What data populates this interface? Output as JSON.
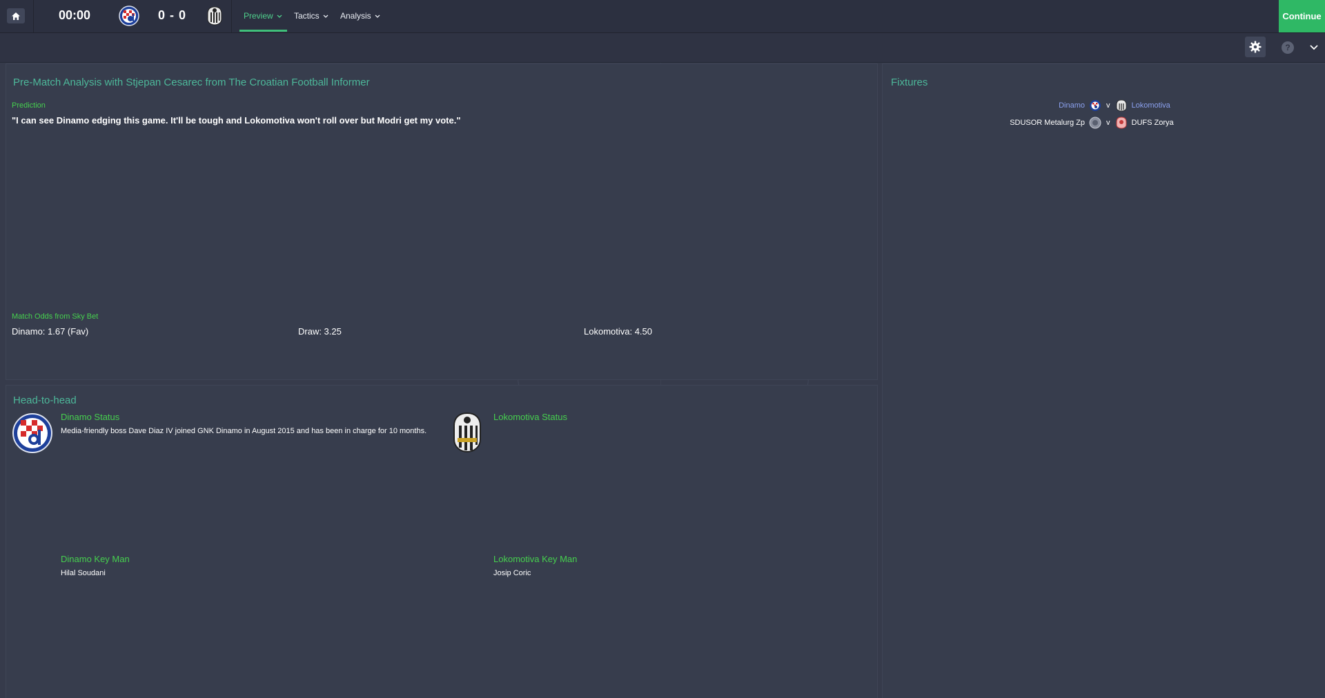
{
  "topbar": {
    "clock": "00:00",
    "score": "0 - 0",
    "tabs": [
      {
        "label": "Preview",
        "active": true
      },
      {
        "label": "Tactics",
        "active": false
      },
      {
        "label": "Analysis",
        "active": false
      }
    ],
    "continue_label": "Continue"
  },
  "analysis": {
    "title": "Pre-Match Analysis with Stjepan Cesarec from The Croatian Football Informer",
    "prediction_label": "Prediction",
    "prediction_text": "\"I can see Dinamo edging this game. It'll be tough and Lokomotiva won't roll over but Modri get my vote.\"",
    "odds_label": "Match Odds from Sky Bet",
    "odds": {
      "home": "Dinamo: 1.67 (Fav)",
      "draw": "Draw: 3.25",
      "away": "Lokomotiva: 4.50"
    }
  },
  "head_to_head": {
    "title": "Head-to-head",
    "home": {
      "status_title": "Dinamo Status",
      "status_text": "Media-friendly boss Dave Diaz IV joined GNK Dinamo in August 2015 and has been in charge for 10 months.",
      "key_man_title": "Dinamo Key Man",
      "key_man": "Hilal Soudani"
    },
    "away": {
      "status_title": "Lokomotiva Status",
      "key_man_title": "Lokomotiva Key Man",
      "key_man": "Josip Coric"
    }
  },
  "fixtures": {
    "title": "Fixtures",
    "rows": [
      {
        "home": "Dinamo",
        "v": "v",
        "away": "Lokomotiva"
      },
      {
        "home": "SDUSOR Metalurg Zp",
        "v": "v",
        "away": "DUFS Zorya"
      }
    ]
  },
  "colors": {
    "accent_green": "#46d04e",
    "title_teal": "#4db89a",
    "continue_bg": "#2fb865",
    "link_blue": "#8ca2f0"
  }
}
